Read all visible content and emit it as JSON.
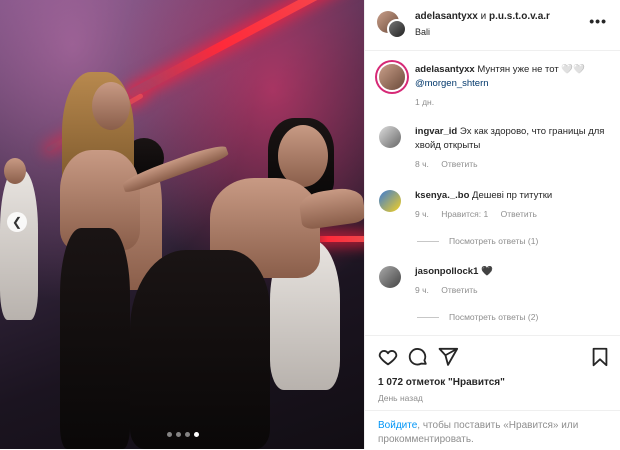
{
  "post": {
    "author": "adelasantyxx",
    "connector": "и",
    "coauthor": "p.u.s.t.o.v.a.r",
    "location": "Bali",
    "more_icon": "more-dots-icon"
  },
  "caption": {
    "user": "adelasantyxx",
    "text": "Мунтян уже не тот 🤍🤍",
    "mention": "@morgen_shtern",
    "time": "1 дн."
  },
  "comments": [
    {
      "user": "ingvar_id",
      "text": "Эх как здорово, что границы для хвойд открыты",
      "time": "8 ч.",
      "reply": "Ответить",
      "likes": ""
    },
    {
      "user": "ksenya._.bo",
      "text": "Дешеві пр титутки",
      "time": "9 ч.",
      "likes": "Нравится: 1",
      "reply": "Ответить",
      "replies": "Посмотреть ответы (1)"
    },
    {
      "user": "jasonpollock1",
      "text": "🖤",
      "time": "9 ч.",
      "reply": "Ответить",
      "replies": "Посмотреть ответы (2)"
    }
  ],
  "stats": {
    "likes": "1 072 отметок \"Нравится\"",
    "ago": "День назад"
  },
  "login": {
    "link": "Войдите",
    "text": ", чтобы поставить «Нравится» или прокомментировать."
  },
  "carousel": {
    "total": 4,
    "active": 4
  }
}
